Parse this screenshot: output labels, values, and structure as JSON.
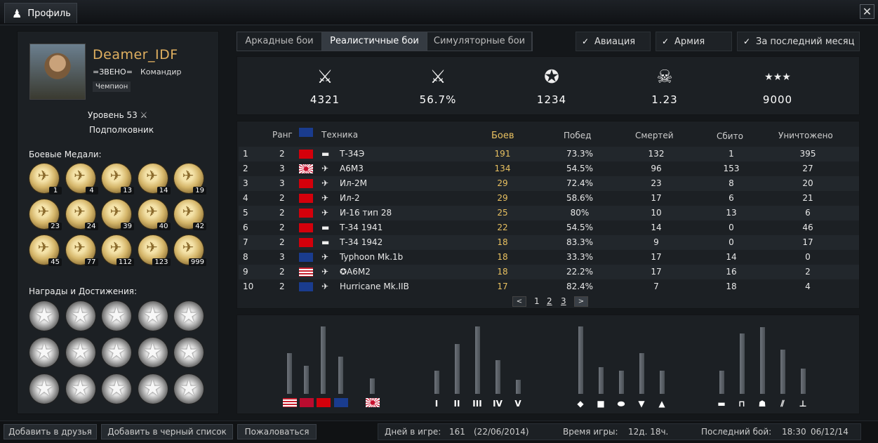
{
  "window": {
    "title": "Профиль",
    "close_symbol": "✕"
  },
  "profile": {
    "nickname": "Deamer_IDF",
    "clan": "=ЗВЕНО=",
    "clan_role": "Командир",
    "title_badge": "Чемпион",
    "level": "Уровень 53",
    "rank": "Подполковник"
  },
  "medals_section": {
    "title": "Боевые Медали:",
    "counts": [
      "1",
      "4",
      "13",
      "14",
      "19",
      "23",
      "24",
      "39",
      "40",
      "42",
      "45",
      "77",
      "112",
      "123",
      "999"
    ]
  },
  "awards_section": {
    "title": "Награды и Достижения:",
    "count": 15
  },
  "mode_tabs": [
    {
      "label": "Аркадные бои",
      "active": false
    },
    {
      "label": "Реалистичные бои",
      "active": true
    },
    {
      "label": "Симуляторные бои",
      "active": false
    }
  ],
  "filters": [
    {
      "label": "Авиация",
      "checked": true
    },
    {
      "label": "Армия",
      "checked": true
    },
    {
      "label": "За последний месяц",
      "checked": true
    }
  ],
  "summary_stats": [
    {
      "icon": "crossed-swords-icon",
      "glyph": "⚔",
      "value": "4321"
    },
    {
      "icon": "victory-swords-icon",
      "glyph": "⚔",
      "value": "56.7%"
    },
    {
      "icon": "rank-star-icon",
      "glyph": "✪",
      "value": "1234"
    },
    {
      "icon": "skull-icon",
      "glyph": "☠",
      "value": "1.23"
    },
    {
      "icon": "stars-icon",
      "glyph": "★★★",
      "value": "9000"
    }
  ],
  "table": {
    "headers": {
      "rank": "Ранг",
      "vehicle": "Техника",
      "battles": "Боев",
      "wins": "Побед",
      "deaths": "Смертей",
      "shot_down": "Сбито",
      "destroyed": "Уничтожено"
    },
    "header_flag": "uk",
    "rows": [
      {
        "n": "1",
        "rank": "2",
        "flag": "ussr",
        "type": "tank",
        "vehicle": "Т-34Э",
        "battles": "191",
        "wins": "73.3%",
        "deaths": "132",
        "shot": "1",
        "destroyed": "395"
      },
      {
        "n": "2",
        "rank": "3",
        "flag": "jp",
        "type": "plane",
        "vehicle": "A6M3",
        "battles": "134",
        "wins": "54.5%",
        "deaths": "96",
        "shot": "153",
        "destroyed": "27"
      },
      {
        "n": "3",
        "rank": "3",
        "flag": "ussr",
        "type": "plane",
        "vehicle": "Ил-2М",
        "battles": "29",
        "wins": "72.4%",
        "deaths": "23",
        "shot": "8",
        "destroyed": "20"
      },
      {
        "n": "4",
        "rank": "2",
        "flag": "ussr",
        "type": "plane",
        "vehicle": "Ил-2",
        "battles": "29",
        "wins": "58.6%",
        "deaths": "17",
        "shot": "6",
        "destroyed": "21"
      },
      {
        "n": "5",
        "rank": "2",
        "flag": "ussr",
        "type": "plane",
        "vehicle": "И-16 тип 28",
        "battles": "25",
        "wins": "80%",
        "deaths": "10",
        "shot": "13",
        "destroyed": "6"
      },
      {
        "n": "6",
        "rank": "2",
        "flag": "ussr",
        "type": "tank",
        "vehicle": "Т-34 1941",
        "battles": "22",
        "wins": "54.5%",
        "deaths": "14",
        "shot": "0",
        "destroyed": "46"
      },
      {
        "n": "7",
        "rank": "2",
        "flag": "ussr",
        "type": "tank",
        "vehicle": "Т-34 1942",
        "battles": "18",
        "wins": "83.3%",
        "deaths": "9",
        "shot": "0",
        "destroyed": "17"
      },
      {
        "n": "8",
        "rank": "3",
        "flag": "uk",
        "type": "plane",
        "vehicle": "Typhoon Mk.1b",
        "battles": "18",
        "wins": "33.3%",
        "deaths": "17",
        "shot": "14",
        "destroyed": "0"
      },
      {
        "n": "9",
        "rank": "2",
        "flag": "us",
        "type": "plane",
        "vehicle": "✪A6M2",
        "battles": "18",
        "wins": "22.2%",
        "deaths": "17",
        "shot": "16",
        "destroyed": "2"
      },
      {
        "n": "10",
        "rank": "2",
        "flag": "uk",
        "type": "plane",
        "vehicle": "Hurricane Mk.IIB",
        "battles": "17",
        "wins": "82.4%",
        "deaths": "7",
        "shot": "18",
        "destroyed": "4"
      }
    ]
  },
  "pager": {
    "prev": "<",
    "pages": [
      "1",
      "2",
      "3"
    ],
    "current": "1",
    "next": ">"
  },
  "bar_charts": [
    {
      "group": "nations",
      "labels": [
        "us",
        "nor",
        "ussr",
        "uk",
        "jp"
      ],
      "values": [
        0.6,
        0.42,
        1.0,
        0.55,
        0.23
      ]
    },
    {
      "group": "ranks",
      "labels": [
        "I",
        "II",
        "III",
        "IV",
        "V"
      ],
      "values": [
        0.34,
        0.74,
        1.0,
        0.5,
        0.21
      ]
    },
    {
      "group": "roles",
      "labels": [
        "◆",
        "■",
        "⬬",
        "▼",
        "▲"
      ],
      "values": [
        1.0,
        0.4,
        0.34,
        0.6,
        0.34
      ]
    },
    {
      "group": "vehicle_types",
      "labels": [
        "▬",
        "⊓",
        "☗",
        "⫽",
        "⊥"
      ],
      "values": [
        0.34,
        0.9,
        0.99,
        0.66,
        0.38
      ]
    }
  ],
  "bottom_buttons": [
    "Добавить в друзья",
    "Добавить в черный список",
    "Пожаловаться"
  ],
  "bottom_stats": {
    "days_label": "Дней в игре:",
    "days_value": "161",
    "days_since": "(22/06/2014)",
    "playtime_label": "Время игры:",
    "playtime_value": "12д. 18ч.",
    "last_battle_label": "Последний бой:",
    "last_battle_time": "18:30",
    "last_battle_date": "06/12/14"
  },
  "colors": {
    "accent": "#e0b060",
    "battles": "#e8c060",
    "panel": "#1c2024"
  }
}
